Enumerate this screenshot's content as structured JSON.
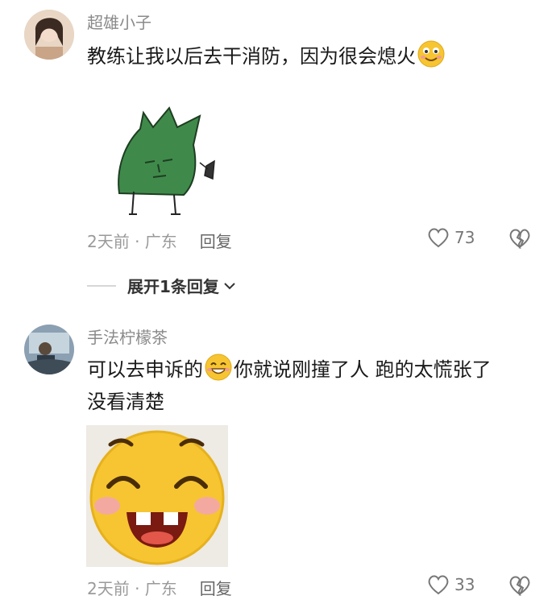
{
  "comments": [
    {
      "username": "超雄小子",
      "text_before_emoji": "教练让我以后去干消防，因为很会熄火",
      "emoji_name": "smile-emoji",
      "sticker_name": "green-leaf-sticker",
      "time_location": "2天前 · 广东",
      "reply_label": "回复",
      "likes": "73"
    },
    {
      "username": "手法柠檬茶",
      "text_before_emoji": "可以去申诉的",
      "emoji_name": "grin-emoji",
      "text_after_emoji": "你就说刚撞了人 跑的太慌张了",
      "text_line2": "没看清楚",
      "sticker_name": "laughing-face-sticker",
      "time_location": "2天前 · 广东",
      "reply_label": "回复",
      "likes": "33"
    }
  ],
  "expand_replies": {
    "label": "展开1条回复"
  },
  "colors": {
    "meta": "#9a9a9a",
    "username": "#8a8a8a",
    "sticker_green": "#3f8a4a",
    "emoji_yellow": "#f6c531"
  }
}
